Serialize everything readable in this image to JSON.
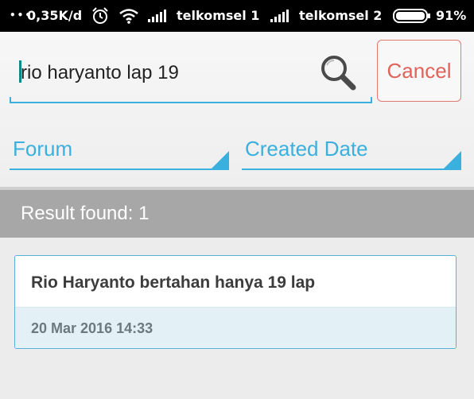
{
  "status_bar": {
    "speed": "0,35K/d",
    "carrier1": "telkomsel 1",
    "carrier2": "telkomsel 2",
    "battery": "91%",
    "icons": [
      "alarm-icon",
      "wifi-icon",
      "signal-icon",
      "battery-icon"
    ]
  },
  "search": {
    "value": "rio haryanto lap 19",
    "cancel_label": "Cancel"
  },
  "filters": {
    "forum_label": "Forum",
    "date_label": "Created Date"
  },
  "results": {
    "summary": "Result found: 1",
    "items": [
      {
        "title": "Rio Haryanto bertahan hanya 19 lap",
        "date": "20 Mar 2016 14:33"
      }
    ]
  },
  "colors": {
    "accent": "#3ab0de",
    "cancel": "#e0625a",
    "result_bar": "#a7a7a7",
    "card_meta_bg": "#e3f0f5"
  }
}
